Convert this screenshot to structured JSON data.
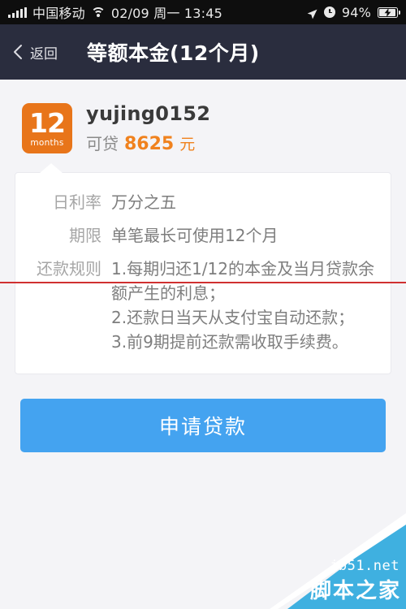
{
  "status_bar": {
    "carrier": "中国移动",
    "datetime": "02/09 周一 13:45",
    "battery_percent": "94%",
    "icons": [
      "signal-bars-icon",
      "wifi-icon",
      "location-arrow-icon",
      "alarm-clock-icon",
      "battery-charging-icon"
    ]
  },
  "nav_bar": {
    "back_label": "返回",
    "title": "等额本金(12个月)",
    "background_color": "#2A2D3E"
  },
  "profile": {
    "badge_number": "12",
    "badge_unit": "months",
    "badge_color": "#E8751A",
    "username": "yujing0152",
    "credit_label": "可贷",
    "credit_amount": "8625",
    "credit_unit": "元",
    "credit_accent_color": "#F0821E"
  },
  "info_card": {
    "rows": [
      {
        "label": "日利率",
        "value": "万分之五"
      },
      {
        "label": "期限",
        "value": "单笔最长可使用12个月"
      }
    ],
    "rules_label": "还款规则",
    "rules": [
      "1.每期归还1/12的本金及当月贷款余额产生的利息；",
      "2.还款日当天从支付宝自动还款；",
      "3.前9期提前还款需收取手续费。"
    ]
  },
  "cta": {
    "label": "申请贷款",
    "color": "#44A3F0"
  },
  "watermark": {
    "site": "jb51.net",
    "name": "脚本之家",
    "color": "#3FB0E0"
  }
}
